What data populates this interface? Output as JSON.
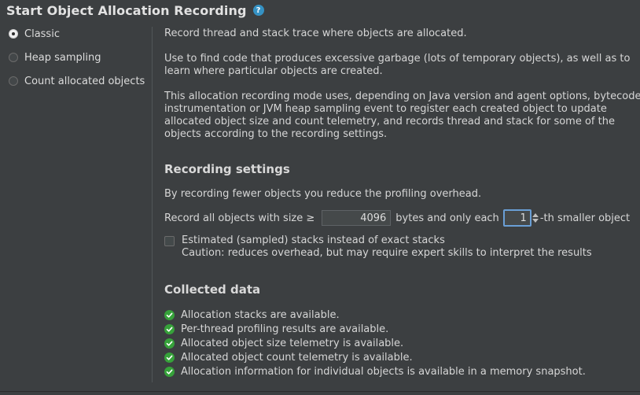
{
  "header": {
    "title": "Start Object Allocation Recording",
    "help_icon": "question-circle-icon",
    "help_glyph": "?"
  },
  "modes": [
    {
      "label": "Classic",
      "selected": true
    },
    {
      "label": "Heap sampling",
      "selected": false
    },
    {
      "label": "Count allocated objects",
      "selected": false
    }
  ],
  "description": {
    "line1": "Record thread and stack trace where objects are allocated.",
    "para2_line1": "Use to find code that produces excessive garbage (lots of temporary objects), as well as to",
    "para2_line2": "learn where particular objects are created.",
    "para3_line1": "This allocation recording mode uses, depending on Java version and agent options, bytecode",
    "para3_line2": "instrumentation or JVM heap sampling event to register each created object to update",
    "para3_line3": "allocated object size and count telemetry, and records thread and stack for some of the",
    "para3_line4": "objects according to the recording settings."
  },
  "recording_settings": {
    "title": "Recording settings",
    "hint": "By recording fewer objects you reduce the profiling overhead.",
    "size_prefix": "Record all objects with size ≥",
    "size_value": "4096",
    "size_suffix": "bytes and only each",
    "each_value": "1",
    "each_suffix": "-th smaller object",
    "estimated_label": "Estimated (sampled) stacks instead of exact stacks",
    "estimated_caution": "Caution: reduces overhead, but may require expert skills to interpret the results",
    "estimated_checked": false
  },
  "collected_data": {
    "title": "Collected data",
    "items": [
      "Allocation stacks are available.",
      "Per-thread profiling results are available.",
      "Allocated object size telemetry is available.",
      "Allocated object count telemetry is available.",
      "Allocation information for individual objects is available in a memory snapshot."
    ],
    "item_icon": "green-check-icon"
  },
  "colors": {
    "background": "#3c3f41",
    "accent_focus": "#6a9fd6",
    "check_green": "#36a23a",
    "help_blue": "#3592c4"
  }
}
